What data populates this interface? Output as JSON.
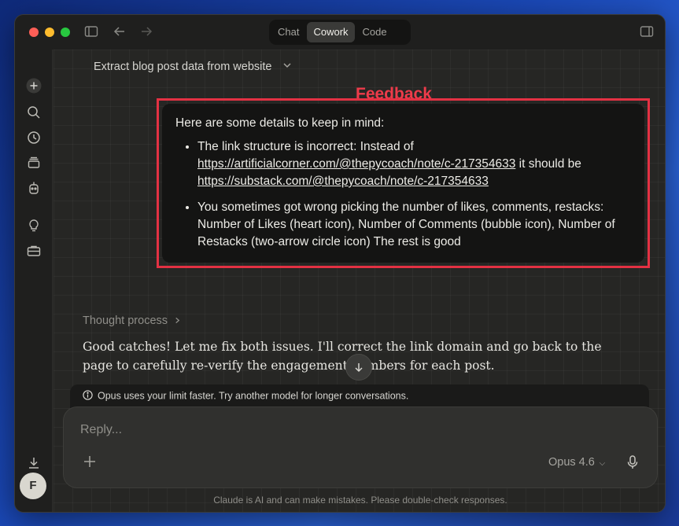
{
  "window": {
    "modes": [
      {
        "label": "Chat",
        "active": false
      },
      {
        "label": "Cowork",
        "active": true
      },
      {
        "label": "Code",
        "active": false
      }
    ]
  },
  "sidebar": {
    "icons": [
      "new-chat-icon",
      "search-icon",
      "history-icon",
      "projects-icon",
      "agent-icon",
      "ideas-icon",
      "briefcase-icon",
      "download-icon"
    ],
    "avatar_initial": "F"
  },
  "conversation": {
    "title": "Extract blog post data from website",
    "annotation_label": "Feedback",
    "user_message": {
      "intro": "Here are some details to keep in mind:",
      "bullet1_prefix": "The link structure is incorrect: Instead of ",
      "bullet1_link1": "https://artificialcorner.com/@thepycoach/note/c-217354633",
      "bullet1_middle": " it should be ",
      "bullet1_link2": "https://substack.com/@thepycoach/note/c-217354633",
      "bullet2": "You sometimes got wrong picking the number of likes, comments, restacks: Number of Likes (heart icon), Number of Comments (bubble icon), Number of Restacks (two-arrow circle icon) The rest is good"
    },
    "thought_process_label": "Thought process",
    "assistant_reply": "Good catches! Let me fix both issues. I'll correct the link domain and go back to the page to carefully re-verify the engagement numbers for each post."
  },
  "notice": {
    "text": "Opus uses your limit faster. Try another model for longer conversations."
  },
  "composer": {
    "placeholder": "Reply...",
    "model": "Opus 4.6"
  },
  "footer": {
    "disclaimer": "Claude is AI and can make mistakes. Please double-check responses."
  },
  "colors": {
    "annotation_red": "#e33143",
    "background": "#262624"
  }
}
